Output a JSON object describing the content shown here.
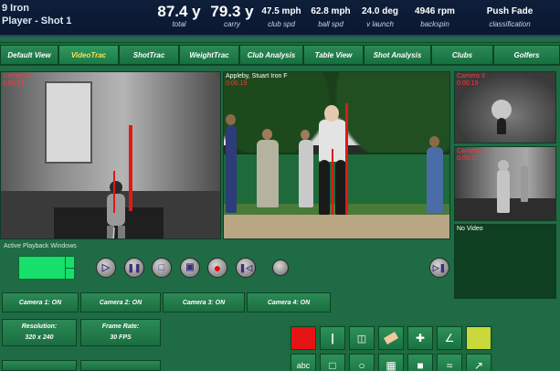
{
  "shot": {
    "club": "9 Iron",
    "player": "Player - Shot 1"
  },
  "stats": [
    {
      "value": "87.4 y",
      "label": "total"
    },
    {
      "value": "79.3 y",
      "label": "carry"
    },
    {
      "value": "47.5 mph",
      "label": "club spd"
    },
    {
      "value": "62.8 mph",
      "label": "ball spd"
    },
    {
      "value": "24.0 deg",
      "label": "v launch"
    },
    {
      "value": "4946 rpm",
      "label": "backspin"
    },
    {
      "value": "Push Fade",
      "label": "classification"
    }
  ],
  "tabs": [
    {
      "label": "Default View"
    },
    {
      "label": "VideoTrac",
      "active": true
    },
    {
      "label": "ShotTrac"
    },
    {
      "label": "WeightTrac"
    },
    {
      "label": "Club Analysis"
    },
    {
      "label": "Table View"
    },
    {
      "label": "Shot Analysis"
    },
    {
      "label": "Clubs"
    },
    {
      "label": "Golfers"
    }
  ],
  "panes": {
    "cam4": {
      "name": "Camera 4",
      "time": "0:00.19"
    },
    "main": {
      "name": "Appleby, Stuart Iron F",
      "time": "0:00.19"
    },
    "cam3": {
      "name": "Camera 3",
      "time": "0:00.19"
    },
    "cam1": {
      "name": "Camera 1",
      "time": "0:00.19"
    },
    "novideo": {
      "name": "No Video"
    }
  },
  "playback": {
    "label": "Active Playback Windows"
  },
  "camera_status": [
    {
      "label": "Camera 1:  ON"
    },
    {
      "label": "Camera 2:  ON"
    },
    {
      "label": "Camera 3:  ON"
    },
    {
      "label": "Camera 4:  ON"
    }
  ],
  "settings": {
    "resolution": {
      "title": "Resolution:",
      "value": "320 x 240"
    },
    "frame_rate": {
      "title": "Frame Rate:",
      "value": "30 FPS"
    }
  },
  "toolbar": {
    "text_tool": "abc"
  },
  "colors": {
    "accent_green": "#16e06b",
    "record_red": "#e01010",
    "caption_red": "#ff3838",
    "active_tab": "#f5e25a"
  }
}
